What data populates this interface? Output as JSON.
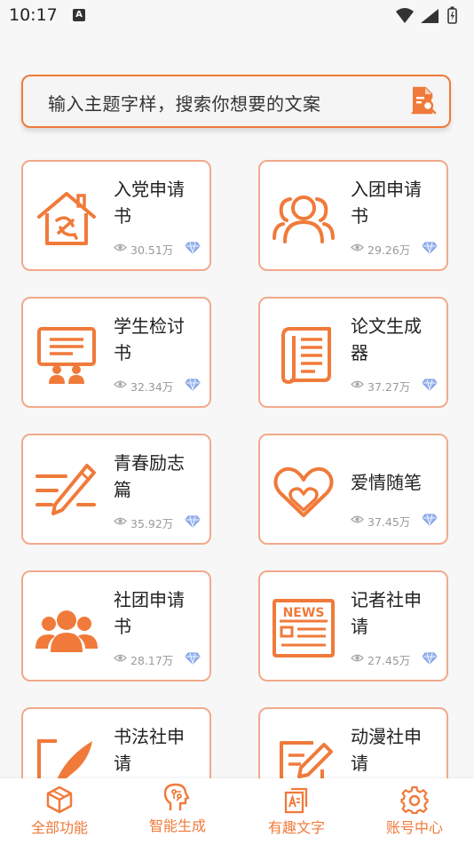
{
  "status": {
    "time": "10:17",
    "notification_glyph": "A"
  },
  "search": {
    "placeholder": "输入主题字样，搜索你想要的文案",
    "icon": "document-search-icon"
  },
  "accent_color": "#f07a3a",
  "cards": [
    {
      "title": "入党申请书",
      "views": "30.51万",
      "icon": "party-house-icon"
    },
    {
      "title": "入团申请书",
      "views": "29.26万",
      "icon": "group-people-icon"
    },
    {
      "title": "学生检讨书",
      "views": "32.34万",
      "icon": "presentation-board-icon"
    },
    {
      "title": "论文生成器",
      "views": "37.27万",
      "icon": "paper-scroll-icon"
    },
    {
      "title": "青春励志篇",
      "views": "35.92万",
      "icon": "pen-writing-icon"
    },
    {
      "title": "爱情随笔",
      "views": "37.45万",
      "icon": "double-heart-icon"
    },
    {
      "title": "社团申请书",
      "views": "28.17万",
      "icon": "club-people-icon"
    },
    {
      "title": "记者社申请",
      "views": "27.45万",
      "icon": "newspaper-icon"
    },
    {
      "title": "书法社申请",
      "views": "",
      "icon": "quill-icon"
    },
    {
      "title": "动漫社申请",
      "views": "",
      "icon": "edit-document-icon"
    }
  ],
  "news_icon_text": "NEWS",
  "nav": [
    {
      "label": "全部功能",
      "icon": "box-icon"
    },
    {
      "label": "智能生成",
      "icon": "ai-brain-icon"
    },
    {
      "label": "有趣文字",
      "icon": "text-document-icon"
    },
    {
      "label": "账号中心",
      "icon": "gear-icon"
    }
  ]
}
